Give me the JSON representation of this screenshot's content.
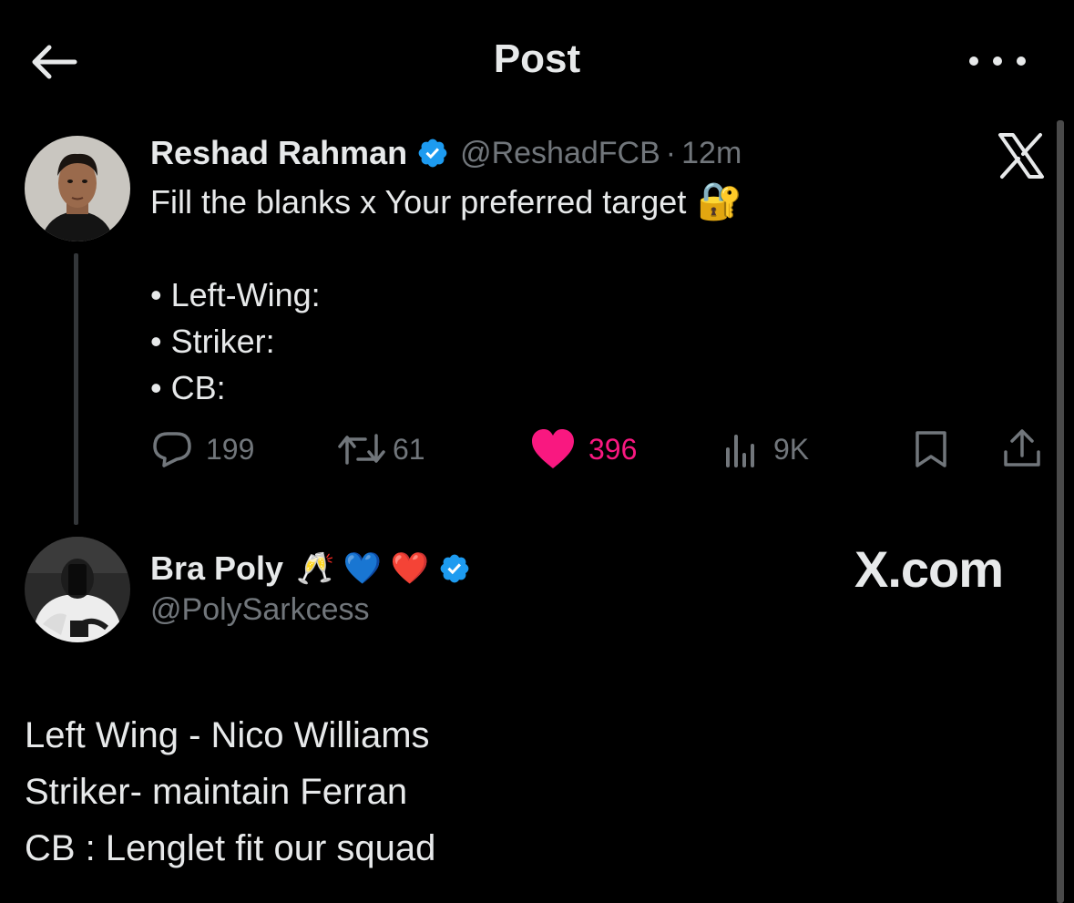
{
  "header": {
    "title": "Post",
    "back_icon": "arrow-left-icon",
    "more_icon": "more-horizontal-icon"
  },
  "tweet1": {
    "author_name": "Reshad Rahman",
    "handle": "@ReshadFCB",
    "separator": "·",
    "time": "12m",
    "lines": [
      "Fill the blanks x Your preferred target",
      "",
      "• Left-Wing:",
      "• Striker:",
      "• CB:"
    ],
    "emoji": "🔐",
    "replies": "199",
    "reposts": "61",
    "likes": "396",
    "views": "9K",
    "liked": true,
    "like_color": "#f91880"
  },
  "tweet2": {
    "author_name": "Bra Poly",
    "name_emojis": "🥂 💙 ❤️",
    "handle": "@PolySarkcess",
    "lines": [
      "Left Wing - Nico Williams",
      "Striker- maintain Ferran",
      "CB : Lenglet fit our squad"
    ]
  },
  "watermark": {
    "text": "X.com"
  },
  "colors": {
    "background": "#000000",
    "text": "#e7e9ea",
    "muted": "#71767b",
    "verified": "#1d9bf0",
    "like": "#f91880"
  }
}
